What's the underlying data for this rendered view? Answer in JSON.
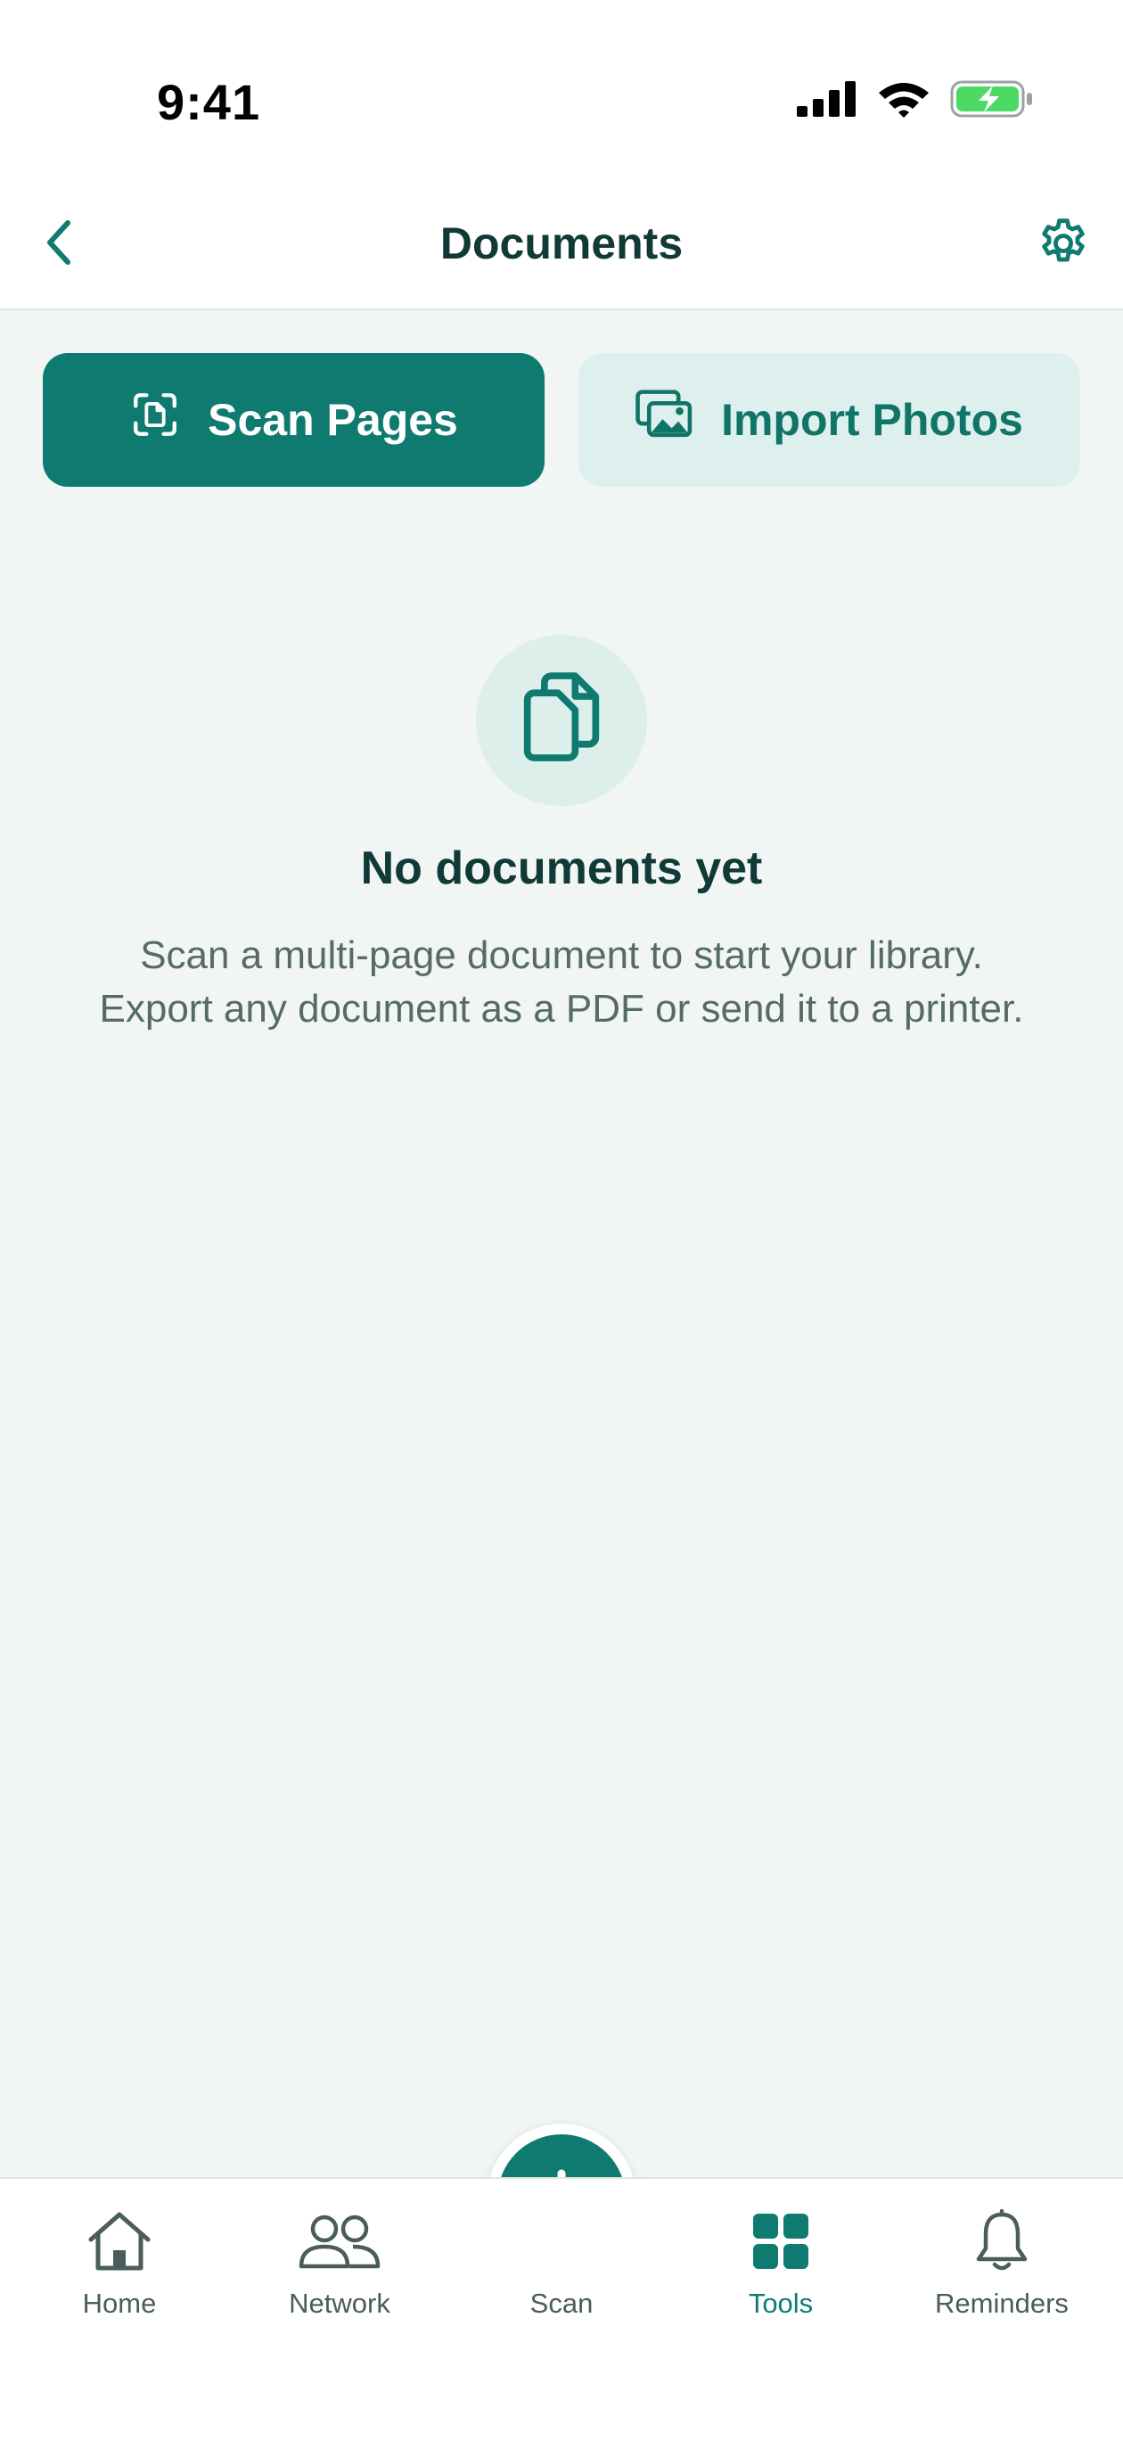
{
  "status_bar": {
    "time": "9:41"
  },
  "header": {
    "title": "Documents",
    "back_icon": "chevron-left-icon",
    "settings_icon": "gear-icon"
  },
  "actions": {
    "scan_label": "Scan Pages",
    "import_label": "Import Photos"
  },
  "empty_state": {
    "title": "No documents yet",
    "description": "Scan a multi-page document to start your library. Export any document as a PDF or send it to a printer."
  },
  "tab_bar": {
    "items": [
      {
        "label": "Home",
        "icon": "home-icon"
      },
      {
        "label": "Network",
        "icon": "people-icon"
      },
      {
        "label": "Scan",
        "icon": "plus-icon"
      },
      {
        "label": "Tools",
        "icon": "grid-icon",
        "active": true
      },
      {
        "label": "Reminders",
        "icon": "bell-icon"
      }
    ]
  },
  "colors": {
    "accent": "#0f7b70",
    "accent_light": "#ddf0ed",
    "background": "#f1f6f5",
    "text_primary": "#113a36",
    "text_secondary": "#566b68",
    "battery": "#4cd964"
  }
}
